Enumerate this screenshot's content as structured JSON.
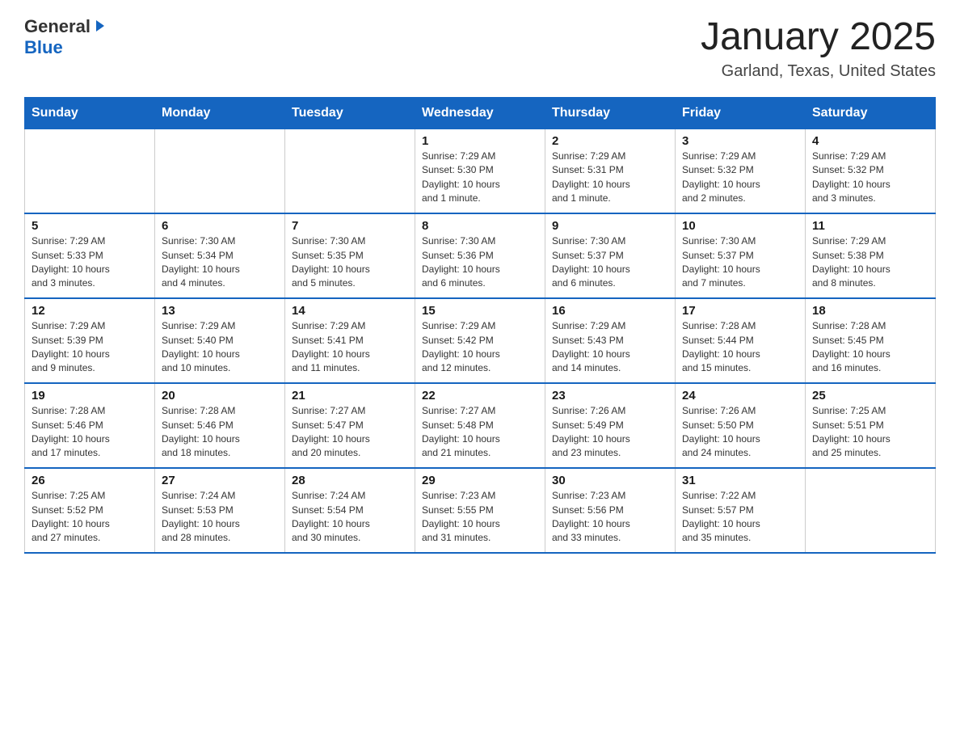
{
  "header": {
    "logo_general": "General",
    "logo_blue": "Blue",
    "month_title": "January 2025",
    "location": "Garland, Texas, United States"
  },
  "days_of_week": [
    "Sunday",
    "Monday",
    "Tuesday",
    "Wednesday",
    "Thursday",
    "Friday",
    "Saturday"
  ],
  "weeks": [
    [
      {
        "day": "",
        "info": ""
      },
      {
        "day": "",
        "info": ""
      },
      {
        "day": "",
        "info": ""
      },
      {
        "day": "1",
        "info": "Sunrise: 7:29 AM\nSunset: 5:30 PM\nDaylight: 10 hours\nand 1 minute."
      },
      {
        "day": "2",
        "info": "Sunrise: 7:29 AM\nSunset: 5:31 PM\nDaylight: 10 hours\nand 1 minute."
      },
      {
        "day": "3",
        "info": "Sunrise: 7:29 AM\nSunset: 5:32 PM\nDaylight: 10 hours\nand 2 minutes."
      },
      {
        "day": "4",
        "info": "Sunrise: 7:29 AM\nSunset: 5:32 PM\nDaylight: 10 hours\nand 3 minutes."
      }
    ],
    [
      {
        "day": "5",
        "info": "Sunrise: 7:29 AM\nSunset: 5:33 PM\nDaylight: 10 hours\nand 3 minutes."
      },
      {
        "day": "6",
        "info": "Sunrise: 7:30 AM\nSunset: 5:34 PM\nDaylight: 10 hours\nand 4 minutes."
      },
      {
        "day": "7",
        "info": "Sunrise: 7:30 AM\nSunset: 5:35 PM\nDaylight: 10 hours\nand 5 minutes."
      },
      {
        "day": "8",
        "info": "Sunrise: 7:30 AM\nSunset: 5:36 PM\nDaylight: 10 hours\nand 6 minutes."
      },
      {
        "day": "9",
        "info": "Sunrise: 7:30 AM\nSunset: 5:37 PM\nDaylight: 10 hours\nand 6 minutes."
      },
      {
        "day": "10",
        "info": "Sunrise: 7:30 AM\nSunset: 5:37 PM\nDaylight: 10 hours\nand 7 minutes."
      },
      {
        "day": "11",
        "info": "Sunrise: 7:29 AM\nSunset: 5:38 PM\nDaylight: 10 hours\nand 8 minutes."
      }
    ],
    [
      {
        "day": "12",
        "info": "Sunrise: 7:29 AM\nSunset: 5:39 PM\nDaylight: 10 hours\nand 9 minutes."
      },
      {
        "day": "13",
        "info": "Sunrise: 7:29 AM\nSunset: 5:40 PM\nDaylight: 10 hours\nand 10 minutes."
      },
      {
        "day": "14",
        "info": "Sunrise: 7:29 AM\nSunset: 5:41 PM\nDaylight: 10 hours\nand 11 minutes."
      },
      {
        "day": "15",
        "info": "Sunrise: 7:29 AM\nSunset: 5:42 PM\nDaylight: 10 hours\nand 12 minutes."
      },
      {
        "day": "16",
        "info": "Sunrise: 7:29 AM\nSunset: 5:43 PM\nDaylight: 10 hours\nand 14 minutes."
      },
      {
        "day": "17",
        "info": "Sunrise: 7:28 AM\nSunset: 5:44 PM\nDaylight: 10 hours\nand 15 minutes."
      },
      {
        "day": "18",
        "info": "Sunrise: 7:28 AM\nSunset: 5:45 PM\nDaylight: 10 hours\nand 16 minutes."
      }
    ],
    [
      {
        "day": "19",
        "info": "Sunrise: 7:28 AM\nSunset: 5:46 PM\nDaylight: 10 hours\nand 17 minutes."
      },
      {
        "day": "20",
        "info": "Sunrise: 7:28 AM\nSunset: 5:46 PM\nDaylight: 10 hours\nand 18 minutes."
      },
      {
        "day": "21",
        "info": "Sunrise: 7:27 AM\nSunset: 5:47 PM\nDaylight: 10 hours\nand 20 minutes."
      },
      {
        "day": "22",
        "info": "Sunrise: 7:27 AM\nSunset: 5:48 PM\nDaylight: 10 hours\nand 21 minutes."
      },
      {
        "day": "23",
        "info": "Sunrise: 7:26 AM\nSunset: 5:49 PM\nDaylight: 10 hours\nand 23 minutes."
      },
      {
        "day": "24",
        "info": "Sunrise: 7:26 AM\nSunset: 5:50 PM\nDaylight: 10 hours\nand 24 minutes."
      },
      {
        "day": "25",
        "info": "Sunrise: 7:25 AM\nSunset: 5:51 PM\nDaylight: 10 hours\nand 25 minutes."
      }
    ],
    [
      {
        "day": "26",
        "info": "Sunrise: 7:25 AM\nSunset: 5:52 PM\nDaylight: 10 hours\nand 27 minutes."
      },
      {
        "day": "27",
        "info": "Sunrise: 7:24 AM\nSunset: 5:53 PM\nDaylight: 10 hours\nand 28 minutes."
      },
      {
        "day": "28",
        "info": "Sunrise: 7:24 AM\nSunset: 5:54 PM\nDaylight: 10 hours\nand 30 minutes."
      },
      {
        "day": "29",
        "info": "Sunrise: 7:23 AM\nSunset: 5:55 PM\nDaylight: 10 hours\nand 31 minutes."
      },
      {
        "day": "30",
        "info": "Sunrise: 7:23 AM\nSunset: 5:56 PM\nDaylight: 10 hours\nand 33 minutes."
      },
      {
        "day": "31",
        "info": "Sunrise: 7:22 AM\nSunset: 5:57 PM\nDaylight: 10 hours\nand 35 minutes."
      },
      {
        "day": "",
        "info": ""
      }
    ]
  ]
}
